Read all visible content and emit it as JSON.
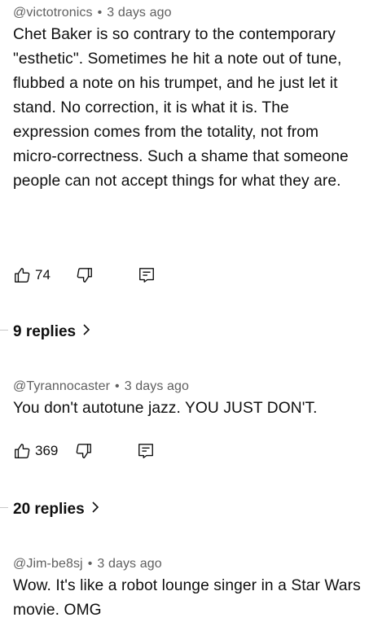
{
  "comments": [
    {
      "author": "@victotronics",
      "time": "3 days ago",
      "text": "Chet Baker is so contrary to the contemporary \"esthetic\". Sometimes he hit a note out of tune, flubbed a note on his trumpet, and he just let it stand. No correction, it is what it is. The expression comes from the totality, not from micro-correctness. Such a shame that someone people can not accept things for what they are.",
      "likes": "74",
      "replies": "9 replies"
    },
    {
      "author": "@Tyrannocaster",
      "time": "3 days ago",
      "text": "You don't autotune jazz. YOU JUST DON'T.",
      "likes": "369",
      "replies": "20 replies"
    },
    {
      "author": "@Jim-be8sj",
      "time": "3 days ago",
      "text": "Wow. It's like a robot lounge singer in a Star Wars movie. OMG"
    }
  ],
  "separator": "•",
  "icons": {
    "like": "thumbs-up-icon",
    "dislike": "thumbs-down-icon",
    "reply": "reply-icon",
    "expand": "chevron-right-icon"
  }
}
